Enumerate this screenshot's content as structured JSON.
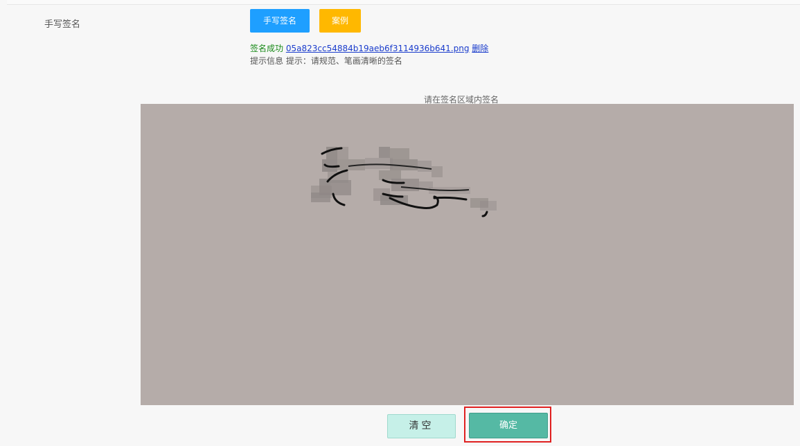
{
  "form": {
    "field_label": "手写签名",
    "sign_button": "手写签名",
    "example_button": "案例"
  },
  "status": {
    "success_text": "签名成功",
    "file_name": "05a823cc54884b19aeb6f3114936b641.png",
    "delete_label": "删除",
    "hint": "提示信息 提示：请规范、笔画清晰的签名"
  },
  "canvas": {
    "title": "请在签名区域内签名",
    "background": "#b5aca9"
  },
  "actions": {
    "clear_label": "清空",
    "confirm_label": "确定"
  },
  "colors": {
    "primary_blue": "#1e9fff",
    "warning_yellow": "#ffb800",
    "confirm_green": "#55b9a4",
    "clear_mint": "#c6f0e8",
    "highlight_red": "#e02020"
  }
}
